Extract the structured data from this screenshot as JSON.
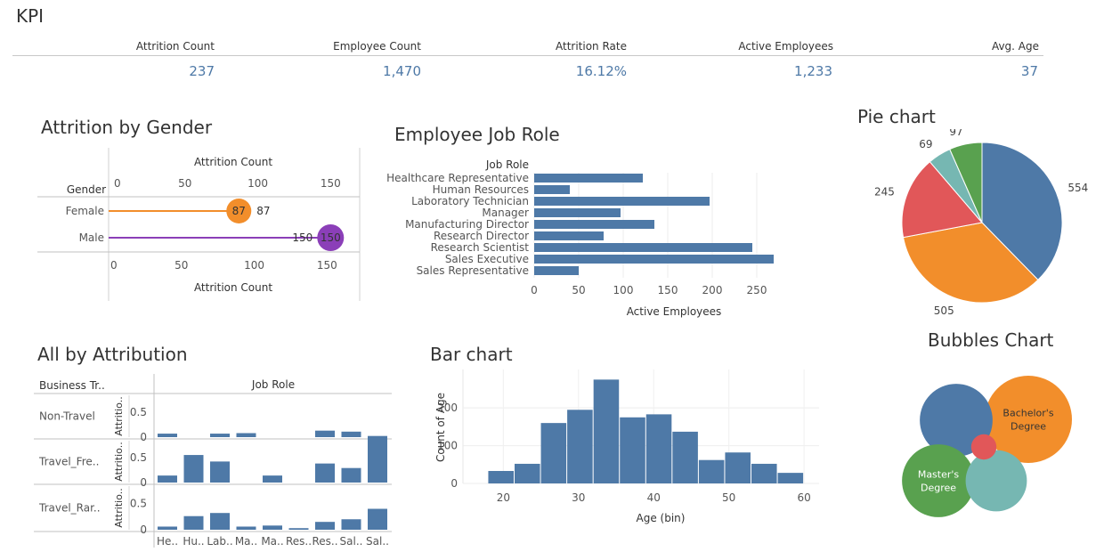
{
  "kpi": {
    "title": "KPI",
    "metrics": [
      {
        "label": "Attrition Count",
        "value": "237"
      },
      {
        "label": "Employee Count",
        "value": "1,470"
      },
      {
        "label": "Attrition Rate",
        "value": "16.12%"
      },
      {
        "label": "Active  Employees",
        "value": "1,233"
      },
      {
        "label": "Avg. Age",
        "value": "37"
      }
    ]
  },
  "colors": {
    "blue": "#4e79a7",
    "orange": "#f28e2b",
    "red": "#e15759",
    "teal": "#76b7b2",
    "green": "#59a14f",
    "purple": "#8b3fb8"
  },
  "chart_data": [
    {
      "id": "gender",
      "type": "lollipop",
      "title": "Attrition by Gender",
      "row_header": "Gender",
      "xlabel_top": "Attrition Count",
      "xlabel_bottom": "Attrition Count",
      "xlim": [
        0,
        170
      ],
      "ticks": [
        0,
        50,
        100,
        150
      ],
      "categories": [
        "Female",
        "Male"
      ],
      "values": [
        87,
        150
      ],
      "bubble_labels": [
        "87",
        "150"
      ],
      "value_labels": [
        "87",
        "150"
      ],
      "colors": [
        "#f28e2b",
        "#8b3fb8"
      ]
    },
    {
      "id": "jobrole",
      "type": "bar",
      "orientation": "horizontal",
      "title": "Employee Job Role",
      "row_header": "Job Role",
      "xlabel": "Active  Employees",
      "xlim": [
        0,
        280
      ],
      "ticks": [
        0,
        50,
        100,
        150,
        200,
        250
      ],
      "categories": [
        "Healthcare Representative",
        "Human Resources",
        "Laboratory Technician",
        "Manager",
        "Manufacturing Director",
        "Research Director",
        "Research Scientist",
        "Sales Executive",
        "Sales Representative"
      ],
      "values": [
        122,
        40,
        197,
        97,
        135,
        78,
        245,
        269,
        50
      ]
    },
    {
      "id": "pie",
      "type": "pie",
      "title": "Pie chart",
      "values": [
        554,
        505,
        245,
        69,
        97
      ],
      "labels": [
        "554",
        "505",
        "245",
        "69",
        "97"
      ],
      "colors": [
        "#4e79a7",
        "#f28e2b",
        "#e15759",
        "#76b7b2",
        "#59a14f"
      ]
    },
    {
      "id": "attribution",
      "type": "bar",
      "title": "All by Attribution",
      "col_header": "Business Tr..",
      "col_group_header": "Job Role",
      "ylabel": "Attritio..",
      "ylim": [
        0,
        0.8
      ],
      "ticks": [
        "0",
        "0.5"
      ],
      "categories": [
        "He..",
        "Hu..",
        "Lab..",
        "Ma..",
        "Ma..",
        "Res..",
        "Res..",
        "Sal..",
        "Sal.."
      ],
      "series": [
        {
          "name": "Non-Travel",
          "values": [
            0.07,
            0,
            0.07,
            0.08,
            0,
            0,
            0.13,
            0.11,
            0
          ]
        },
        {
          "name": "Travel_Fre..",
          "values": [
            0.14,
            0.55,
            0.42,
            0,
            0.14,
            0,
            0.38,
            0.29,
            0.93
          ]
        },
        {
          "name": "Travel_Rar..",
          "values": [
            0.06,
            0.26,
            0.32,
            0.06,
            0.08,
            0.03,
            0.15,
            0.2,
            0.4
          ]
        }
      ]
    },
    {
      "id": "age",
      "type": "bar",
      "title": "Bar chart",
      "xlabel": "Age (bin)",
      "ylabel": "Count of Age",
      "xlim": [
        17,
        62
      ],
      "ylim": [
        0,
        290
      ],
      "xticks": [
        20,
        30,
        40,
        50,
        60
      ],
      "yticks": [
        0,
        100,
        200
      ],
      "bins": [
        18,
        21.5,
        25,
        28.5,
        32,
        35.5,
        39,
        42.5,
        46,
        49.5,
        53,
        56.5
      ],
      "bin_width": 3.5,
      "values": [
        33,
        52,
        160,
        195,
        275,
        175,
        183,
        137,
        62,
        82,
        52,
        28
      ]
    },
    {
      "id": "bubbles",
      "type": "bubble",
      "title": "Bubbles Chart",
      "items": [
        {
          "label": "Bachelor's\nDegree",
          "value": 572,
          "color": "#f28e2b"
        },
        {
          "label": "",
          "value": 398,
          "color": "#4e79a7"
        },
        {
          "label": "Master's\nDegree",
          "value": 398,
          "color": "#59a14f"
        },
        {
          "label": "",
          "value": 282,
          "color": "#76b7b2"
        },
        {
          "label": "",
          "value": 48,
          "color": "#e15759"
        }
      ]
    }
  ]
}
